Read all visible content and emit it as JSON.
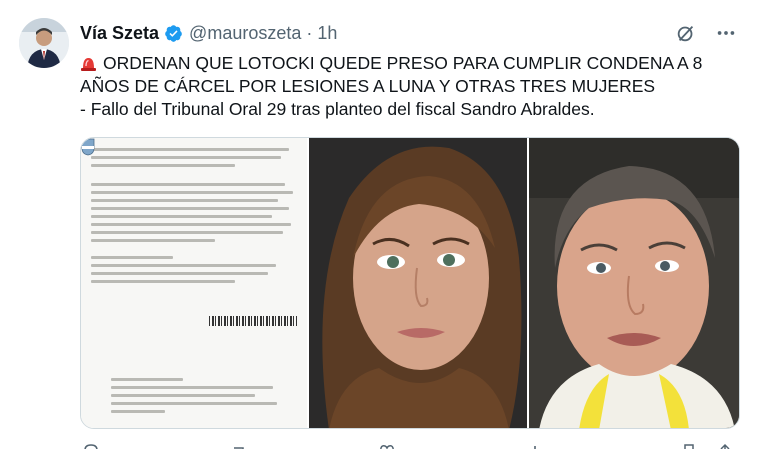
{
  "tweet": {
    "author_name": "Vía Szeta",
    "handle_time": "@mauroszeta · 1h",
    "verified_icon": "verified-badge-icon",
    "accent_color": "#1d9bf0",
    "line1": "ORDENAN QUE LOTOCKI QUEDE PRESO PARA CUMPLIR CONDENA A 8",
    "line2": "AÑOS DE CÁRCEL POR LESIONES A LUNA Y OTRAS TRES MUJERES",
    "line3": "- Fallo del Tribunal Oral 29 tras planteo del fiscal Sandro Abraldes.",
    "siren_icon": "police-siren-icon"
  },
  "media": {
    "panels": [
      "document-photo",
      "woman-photo",
      "man-photo"
    ]
  },
  "header_actions": [
    "grok-icon",
    "more-icon"
  ],
  "action_bar": [
    "reply-icon",
    "retweet-icon",
    "like-icon",
    "views-icon",
    "bookmark-icon",
    "share-icon"
  ]
}
